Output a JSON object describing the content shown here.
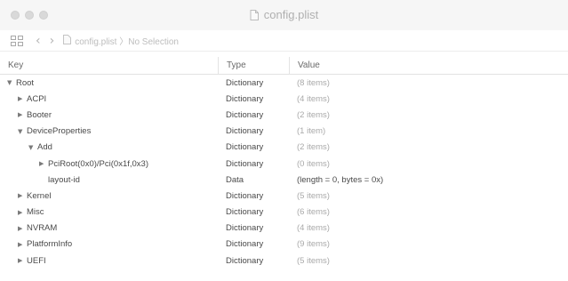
{
  "window": {
    "title": "config.plist"
  },
  "pathbar": {
    "back": "‹",
    "forward": "›",
    "crumb": "config.plist 〉No Selection"
  },
  "columns": {
    "key": "Key",
    "type": "Type",
    "value": "Value"
  },
  "rows": [
    {
      "key": "Root",
      "disclosure": "▼",
      "indent": 0,
      "type": "Dictionary",
      "value": "(8 items)",
      "value_strong": false
    },
    {
      "key": "ACPI",
      "disclosure": "▶",
      "indent": 1,
      "type": "Dictionary",
      "value": "(4 items)",
      "value_strong": false
    },
    {
      "key": "Booter",
      "disclosure": "▶",
      "indent": 1,
      "type": "Dictionary",
      "value": "(2 items)",
      "value_strong": false
    },
    {
      "key": "DeviceProperties",
      "disclosure": "▼",
      "indent": 1,
      "type": "Dictionary",
      "value": "(1 item)",
      "value_strong": false
    },
    {
      "key": "Add",
      "disclosure": "▼",
      "indent": 2,
      "type": "Dictionary",
      "value": "(2 items)",
      "value_strong": false
    },
    {
      "key": "PciRoot(0x0)/Pci(0x1f,0x3)",
      "disclosure": "▶",
      "indent": 3,
      "type": "Dictionary",
      "value": "(0 items)",
      "value_strong": false
    },
    {
      "key": "layout-id",
      "disclosure": "",
      "indent": 3,
      "type": "Data",
      "value": "(length = 0, bytes = 0x)",
      "value_strong": true
    },
    {
      "key": "Kernel",
      "disclosure": "▶",
      "indent": 1,
      "type": "Dictionary",
      "value": "(5 items)",
      "value_strong": false
    },
    {
      "key": "Misc",
      "disclosure": "▶",
      "indent": 1,
      "type": "Dictionary",
      "value": "(6 items)",
      "value_strong": false
    },
    {
      "key": "NVRAM",
      "disclosure": "▶",
      "indent": 1,
      "type": "Dictionary",
      "value": "(4 items)",
      "value_strong": false
    },
    {
      "key": "PlatformInfo",
      "disclosure": "▶",
      "indent": 1,
      "type": "Dictionary",
      "value": "(9 items)",
      "value_strong": false
    },
    {
      "key": "UEFI",
      "disclosure": "▶",
      "indent": 1,
      "type": "Dictionary",
      "value": "(5 items)",
      "value_strong": false
    }
  ]
}
